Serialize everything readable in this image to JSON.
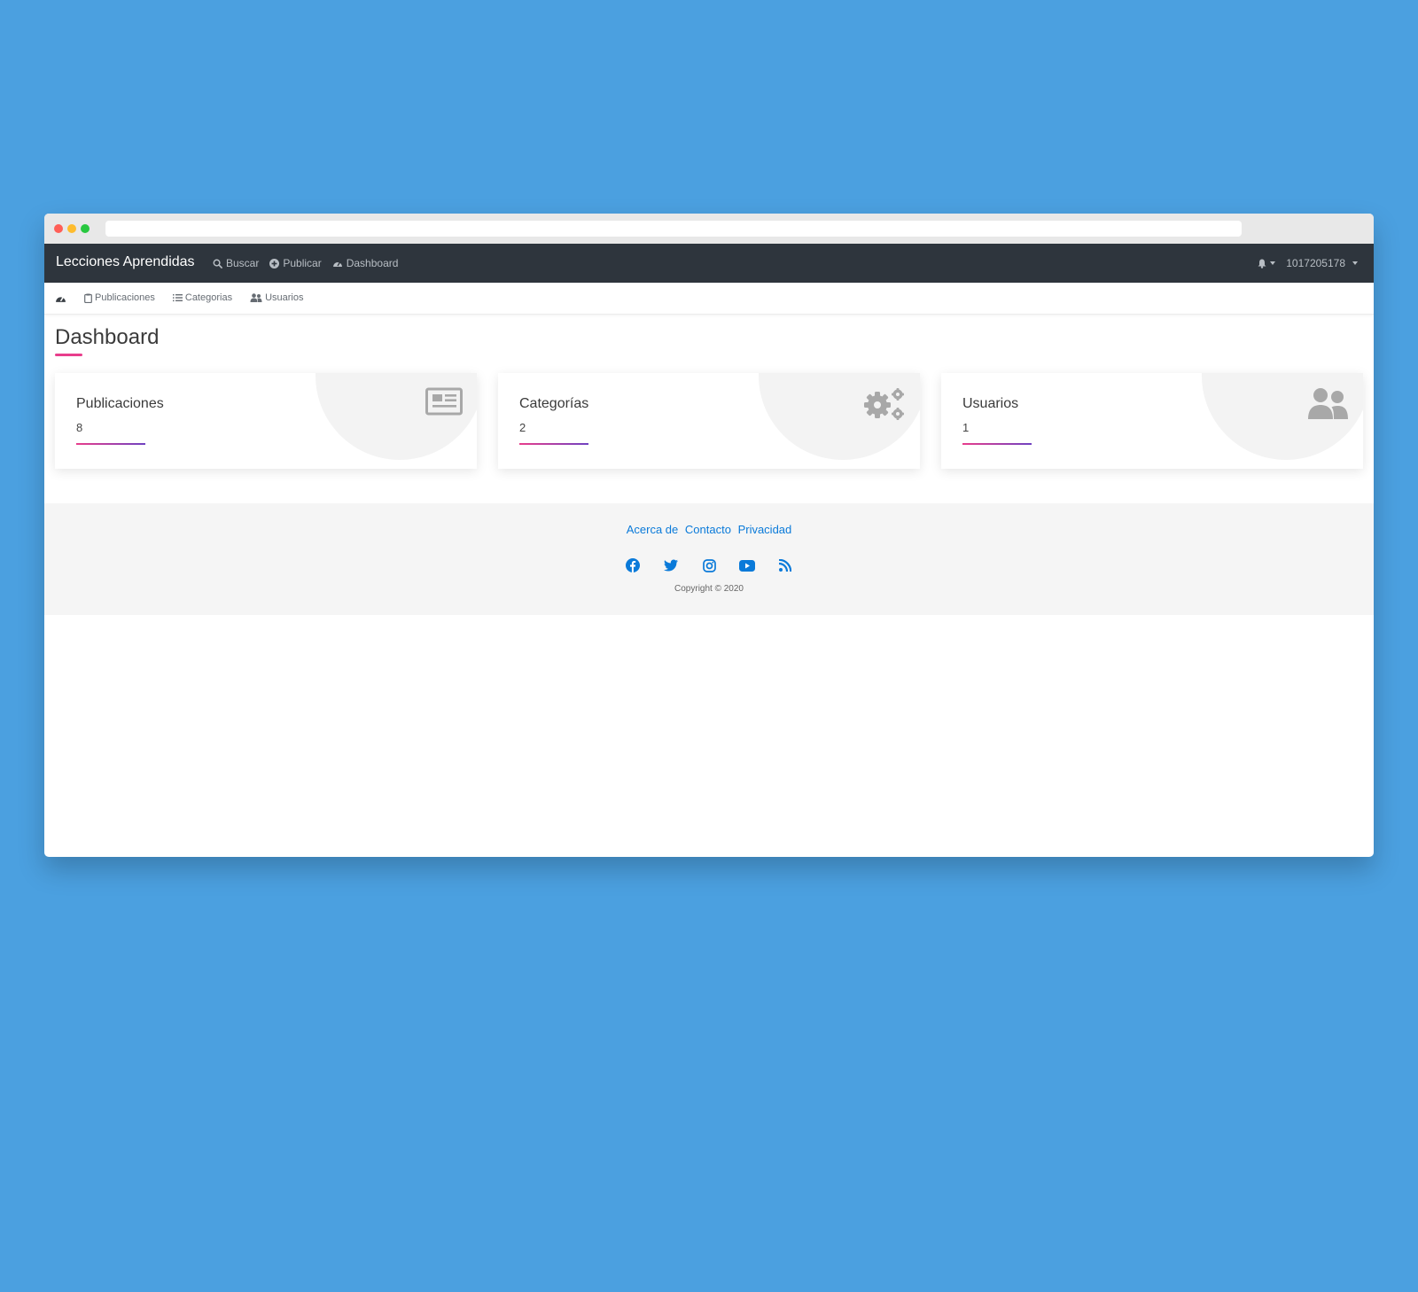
{
  "navbar": {
    "brand": "Lecciones Aprendidas",
    "links": [
      {
        "label": "Buscar",
        "icon": "search-icon"
      },
      {
        "label": "Publicar",
        "icon": "plus-circle-icon"
      },
      {
        "label": "Dashboard",
        "icon": "tachometer-icon"
      }
    ],
    "user": "1017205178"
  },
  "subnav": {
    "items": [
      {
        "label": "Publicaciones",
        "icon": "clipboard-icon"
      },
      {
        "label": "Categorias",
        "icon": "list-icon"
      },
      {
        "label": "Usuarios",
        "icon": "users-icon"
      }
    ]
  },
  "page": {
    "title": "Dashboard"
  },
  "cards": [
    {
      "title": "Publicaciones",
      "value": "8",
      "icon": "newspaper-icon"
    },
    {
      "title": "Categorías",
      "value": "2",
      "icon": "gears-icon"
    },
    {
      "title": "Usuarios",
      "value": "1",
      "icon": "users-icon"
    }
  ],
  "footer": {
    "links": [
      "Acerca de",
      "Contacto",
      "Privacidad"
    ],
    "social": [
      "facebook-icon",
      "twitter-icon",
      "instagram-icon",
      "youtube-icon",
      "rss-icon"
    ],
    "copyright": "Copyright © 2020"
  },
  "colors": {
    "background": "#4ba0e0",
    "navbar": "#2e353d",
    "accent": "#e83e8c",
    "accent2": "#6f42c1",
    "link": "#0a7ad9"
  }
}
